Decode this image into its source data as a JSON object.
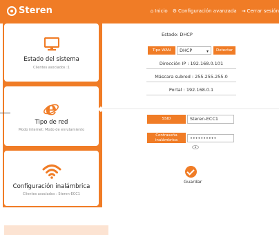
{
  "header": {
    "brand": "Steren",
    "nav": [
      {
        "icon": "home-icon",
        "glyph": "⌂",
        "label": "Inicio"
      },
      {
        "icon": "gear-icon",
        "glyph": "⚙",
        "label": "Configuración avanzada"
      },
      {
        "icon": "logout-icon",
        "glyph": "⇥",
        "label": "Cerrar sesión"
      }
    ]
  },
  "sidebar": {
    "system": {
      "title": "Estado del sistema",
      "subtitle": "Clientes asociados :1"
    },
    "network": {
      "title": "Tipo de red",
      "subtitle": "Modo internet: Modo de enrutamiento"
    },
    "wireless": {
      "title": "Configuración inalámbrica",
      "subtitle": "Clientes asociados : Steren-ECC1"
    }
  },
  "status": {
    "estado": "Estado:  DHCP",
    "wan_label": "Tipo WAN",
    "wan_value": "DHCP",
    "detect_label": "Detectar",
    "ip": "Dirección IP : 192.168.0.101",
    "mask": "Máscara subred : 255.255.255.0",
    "gateway": "Portal : 192.168.0.1"
  },
  "wifi": {
    "ssid_label": "SSID",
    "ssid_value": "Steren-ECC1",
    "password_label": "Contraseña inalámbrica",
    "password_value": "••••••••••",
    "save_label": "Guardar"
  },
  "colors": {
    "accent": "#f07c26"
  }
}
